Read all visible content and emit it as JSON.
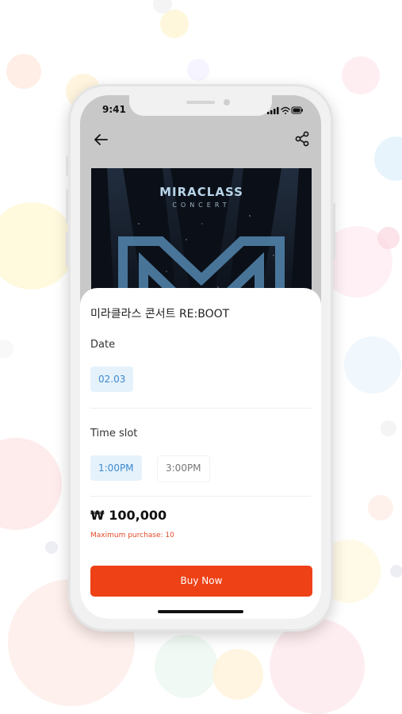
{
  "status_bar": {
    "time": "9:41"
  },
  "nav": {
    "back_icon": "arrow-left-icon",
    "share_icon": "share-icon"
  },
  "poster": {
    "title": "MIRACLASS",
    "subtitle": "CONCERT"
  },
  "event": {
    "title": "미라클라스 콘서트 RE:BOOT"
  },
  "date_section": {
    "label": "Date",
    "options": [
      "02.03"
    ],
    "selected": "02.03"
  },
  "time_section": {
    "label": "Time slot",
    "options": [
      "1:00PM",
      "3:00PM"
    ],
    "selected": "1:00PM"
  },
  "price": {
    "amount": "₩ 100,000",
    "limit_note": "Maximum purchase: 10"
  },
  "actions": {
    "buy_label": "Buy Now"
  },
  "colors": {
    "accent": "#ee4116",
    "chip_selected_bg": "#e6f2fb",
    "chip_selected_text": "#3c8ad0",
    "warning_text": "#e34a28"
  }
}
